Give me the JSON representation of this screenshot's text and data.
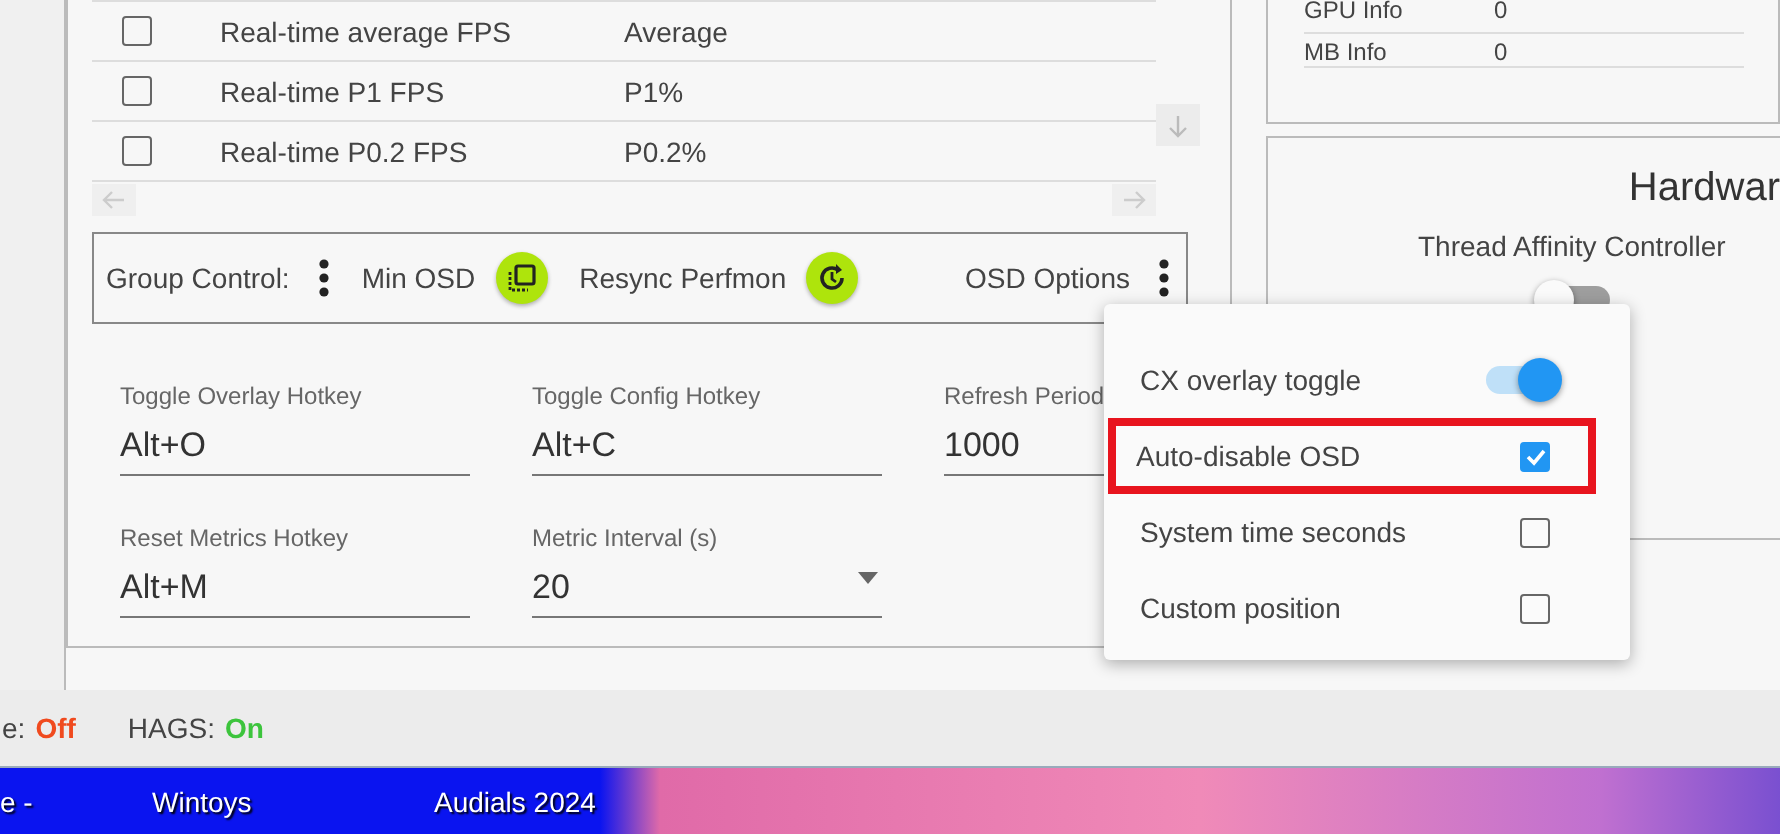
{
  "metrics_table": {
    "rows": [
      {
        "checked": false,
        "name": "Real-time average FPS",
        "column_3": "Average"
      },
      {
        "checked": false,
        "name": "Real-time P1 FPS",
        "column_3": "P1%"
      },
      {
        "checked": false,
        "name": "Real-time P0.2 FPS",
        "column_3": "P0.2%"
      }
    ]
  },
  "group_control": {
    "label": "Group Control:",
    "buttons": [
      {
        "label": "Min OSD",
        "kind": "layers"
      },
      {
        "label": "Resync Perfmon",
        "kind": "refresh"
      }
    ],
    "options_label": "OSD Options"
  },
  "fields": [
    {
      "label": "Toggle Overlay Hotkey",
      "value": "Alt+O",
      "kind": "text"
    },
    {
      "label": "Toggle Config Hotkey",
      "value": "Alt+C",
      "kind": "text"
    },
    {
      "label": "Refresh Period",
      "value": "1000",
      "kind": "text"
    },
    {
      "label": "Reset Metrics Hotkey",
      "value": "Alt+M",
      "kind": "text"
    },
    {
      "label": "Metric Interval (s)",
      "value": "20",
      "kind": "select"
    }
  ],
  "info_table": {
    "rows": [
      {
        "name": "GPU Info",
        "value": "0"
      },
      {
        "name": "MB Info",
        "value": "0"
      }
    ]
  },
  "hardware_panel": {
    "title": "Hardwar",
    "subtitle": "Thread Affinity Controller",
    "toggle_on": false
  },
  "osd_menu": {
    "items": [
      {
        "kind": "toggle",
        "label": "CX overlay toggle",
        "on": true,
        "highlighted": false
      },
      {
        "kind": "checkbox",
        "label": "Auto-disable OSD",
        "checked": true,
        "highlighted": true
      },
      {
        "kind": "checkbox",
        "label": "System time seconds",
        "checked": false,
        "highlighted": false
      },
      {
        "kind": "checkbox",
        "label": "Custom position",
        "checked": false,
        "highlighted": false
      }
    ]
  },
  "status_bar": [
    {
      "label": "e:",
      "value": "Off",
      "on": false
    },
    {
      "label": "HAGS:",
      "value": "On",
      "on": true
    }
  ],
  "taskbar": {
    "items": [
      "e -",
      "Wintoys",
      "Audials 2024"
    ]
  }
}
